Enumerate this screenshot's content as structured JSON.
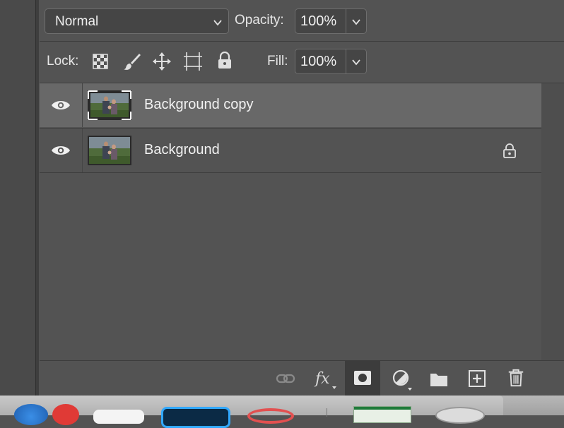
{
  "blend_mode": {
    "selected": "Normal"
  },
  "opacity": {
    "label": "Opacity:",
    "value": "100%"
  },
  "lock": {
    "label": "Lock:"
  },
  "fill": {
    "label": "Fill:",
    "value": "100%"
  },
  "layers": [
    {
      "name": "Background copy",
      "selected": true,
      "locked": false
    },
    {
      "name": "Background",
      "selected": false,
      "locked": true
    }
  ],
  "icons": {
    "visibility": "eye-icon",
    "lock_transparent": "checkerboard-icon",
    "lock_image": "brush-icon",
    "lock_position": "move-arrows-icon",
    "lock_artboard": "artboard-icon",
    "lock_all": "padlock-icon",
    "link": "link-icon",
    "fx": "fx",
    "mask": "layer-mask-icon",
    "adjustment": "adjustment-circle-icon",
    "group": "folder-icon",
    "new_layer": "new-layer-icon",
    "delete": "trash-icon"
  },
  "colors": {
    "panel_bg": "#535353",
    "selected_row": "#686868",
    "field_bg": "#454545"
  }
}
